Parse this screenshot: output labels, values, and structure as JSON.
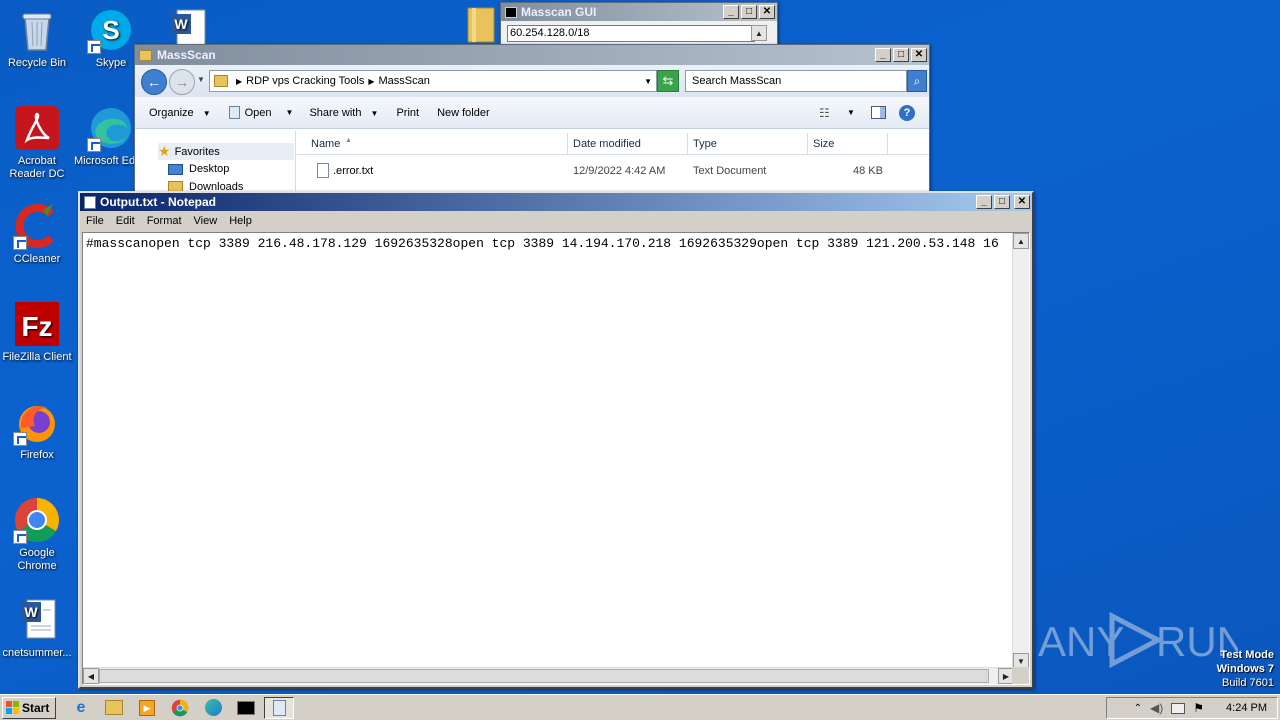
{
  "desktop": {
    "icons": [
      {
        "label": "Recycle Bin"
      },
      {
        "label": "Skype"
      },
      {
        "label": "Acrobat Reader DC"
      },
      {
        "label": "Microsoft Edge"
      },
      {
        "label": "CCleaner"
      },
      {
        "label": "FileZilla Client"
      },
      {
        "label": "Firefox"
      },
      {
        "label": "Google Chrome"
      },
      {
        "label": "cnetsummer..."
      }
    ]
  },
  "masscan_gui": {
    "title": "Masscan GUI",
    "range_value": "60.254.128.0/18"
  },
  "explorer": {
    "title": "MassScan",
    "breadcrumb": [
      "RDP vps Cracking Tools",
      "MassScan"
    ],
    "search_placeholder": "Search MassScan",
    "toolbar": {
      "organize": "Organize",
      "open": "Open",
      "share_with": "Share with",
      "print": "Print",
      "new_folder": "New folder"
    },
    "nav": {
      "favorites": "Favorites",
      "desktop": "Desktop",
      "downloads": "Downloads"
    },
    "columns": [
      "Name",
      "Date modified",
      "Type",
      "Size"
    ],
    "files": [
      {
        "name": ".error.txt",
        "date": "12/9/2022 4:42 AM",
        "type": "Text Document",
        "size": "48 KB"
      }
    ]
  },
  "notepad": {
    "title": "Output.txt - Notepad",
    "menu": [
      "File",
      "Edit",
      "Format",
      "View",
      "Help"
    ],
    "content": "#masscanopen tcp 3389 216.48.178.129 1692635328open tcp 3389 14.194.170.218 1692635329open tcp 3389 121.200.53.148 16"
  },
  "watermark": {
    "text": "ANY RUN",
    "mode_line1": "Test Mode",
    "mode_line2": "Windows 7",
    "mode_line3": "Build 7601"
  },
  "taskbar": {
    "start_label": "Start",
    "clock": "4:24 PM"
  },
  "colors": {
    "desktop_bg": "#0b62cf",
    "title_active": "#0a246a",
    "title_inactive": "#808d9c"
  }
}
